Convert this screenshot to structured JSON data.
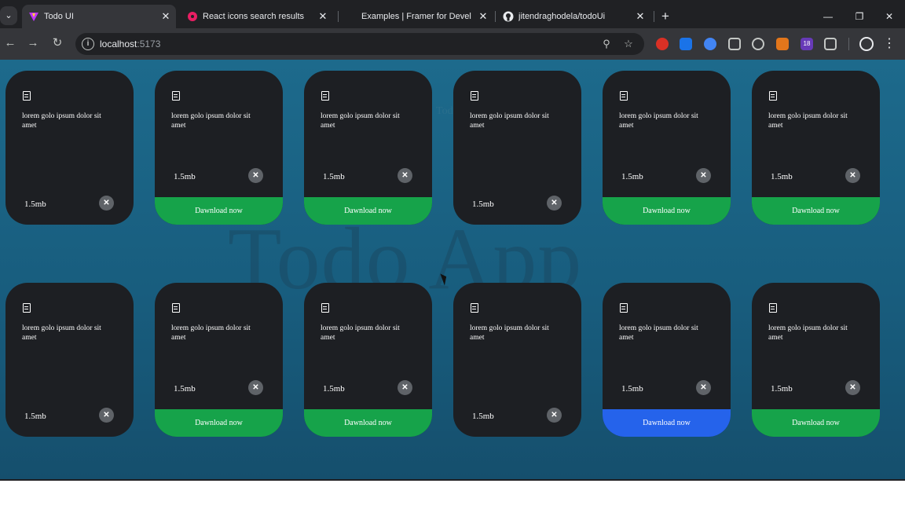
{
  "browser": {
    "tabs": [
      {
        "title": "Todo UI",
        "active": true
      },
      {
        "title": "React icons search results",
        "active": false
      },
      {
        "title": "Examples | Framer for Develop",
        "active": false
      },
      {
        "title": "jitendraghodela/todoUi",
        "active": false
      }
    ],
    "tab_close_glyph": "✕",
    "new_tab_glyph": "+",
    "window_controls": {
      "minimize": "—",
      "restore": "❐",
      "close": "✕"
    },
    "nav": {
      "back": "←",
      "forward": "→",
      "reload": "↻"
    },
    "address": {
      "host": "localhost",
      "port": ":5173"
    },
    "info_glyph": "i",
    "zoom_glyph": "⚲",
    "star_glyph": "☆",
    "extension_badge": "18",
    "menu_glyph": "⋮"
  },
  "page": {
    "background_title": "Todo App",
    "background_small": "Todo",
    "cards": [
      {
        "desc": "lorem golo ipsum dolor sit amet",
        "size": "1.5mb",
        "download": false
      },
      {
        "desc": "lorem golo ipsum dolor sit amet",
        "size": "1.5mb",
        "download": true,
        "download_label": "Dawnload now",
        "color": "green"
      },
      {
        "desc": "lorem golo ipsum dolor sit amet",
        "size": "1.5mb",
        "download": true,
        "download_label": "Dawnload now",
        "color": "green"
      },
      {
        "desc": "lorem golo ipsum dolor sit amet",
        "size": "1.5mb",
        "download": false
      },
      {
        "desc": "lorem golo ipsum dolor sit amet",
        "size": "1.5mb",
        "download": true,
        "download_label": "Dawnload now",
        "color": "green"
      },
      {
        "desc": "lorem golo ipsum dolor sit amet",
        "size": "1.5mb",
        "download": true,
        "download_label": "Dawnload now",
        "color": "green"
      },
      {
        "desc": "lorem golo ipsum dolor sit amet",
        "size": "1.5mb",
        "download": false
      },
      {
        "desc": "lorem golo ipsum dolor sit amet",
        "size": "1.5mb",
        "download": true,
        "download_label": "Dawnload now",
        "color": "green"
      },
      {
        "desc": "lorem golo ipsum dolor sit amet",
        "size": "1.5mb",
        "download": true,
        "download_label": "Dawnload now",
        "color": "green"
      },
      {
        "desc": "lorem golo ipsum dolor sit amet",
        "size": "1.5mb",
        "download": false
      },
      {
        "desc": "lorem golo ipsum dolor sit amet",
        "size": "1.5mb",
        "download": true,
        "download_label": "Dawnload now",
        "color": "blue"
      },
      {
        "desc": "lorem golo ipsum dolor sit amet",
        "size": "1.5mb",
        "download": true,
        "download_label": "Dawnload now",
        "color": "green"
      }
    ],
    "close_glyph": "✕"
  },
  "colors": {
    "download_green": "#16a34a",
    "download_blue": "#2563eb",
    "card_bg": "#1d1f23",
    "page_bg": "#1d6a8c"
  }
}
